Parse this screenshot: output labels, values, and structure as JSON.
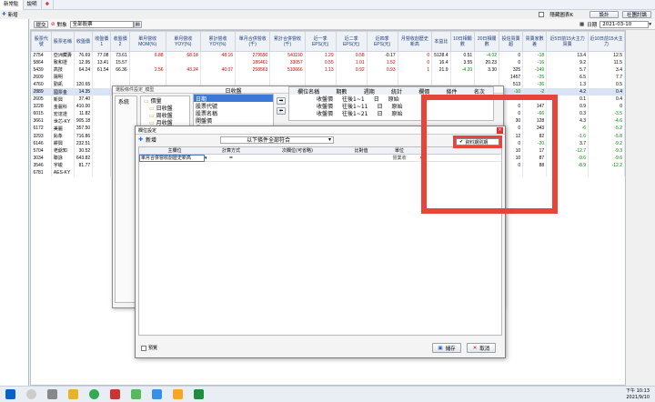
{
  "tabs": [
    "新常駐",
    "說明"
  ],
  "toolbar": {
    "new_label": "新增",
    "right_check": "隱藏圖表K",
    "btn1": "設計",
    "btn2": "社團討論",
    "date_label": "日期",
    "date_value": "2021-03-10"
  },
  "filter": {
    "tag": "提交",
    "label": "對象",
    "combo": "全部股票"
  },
  "grid": {
    "headers": [
      "股票代號",
      "股票名稱",
      "收盤價",
      "收盤價1",
      "收盤價2",
      "單月營收MOM(%)",
      "單月營收YOY(%)",
      "累計營收YOY(%)",
      "單月合併營收(千)",
      "累計合併營收(千)",
      "近一季EPS(元)",
      "近二季EPS(元)",
      "近四季EPS(元)",
      "月營收創歷史新高",
      "本益比",
      "10日相關數",
      "20日相關數",
      "投信買賣超",
      "買賣家數差",
      "近5日前15大主力買賣",
      "近10日前15大主力"
    ],
    "rows": [
      [
        "2754",
        "亞洲藏壽",
        "76.69",
        "77.08",
        "73.61",
        "6.88",
        "68.18",
        "48.16",
        "279590",
        "541190",
        "1.29",
        "0.58",
        "-0.17",
        "0",
        "5128.4",
        "0.51",
        "-4.02",
        "0",
        "-18",
        "13.4",
        "12.5"
      ],
      [
        "5864",
        "致和證",
        "12.95",
        "13.41",
        "15.57",
        "",
        "",
        "",
        "186461",
        "33057",
        "0.55",
        "1.01",
        "1.52",
        "0",
        "16.4",
        "3.55",
        "20.23",
        "0",
        "-16",
        "9.2",
        "11.5"
      ],
      [
        "5439",
        "高技",
        "64.24",
        "61.54",
        "66.36",
        "2.56",
        "43.24",
        "40.07",
        "258563",
        "510666",
        "1.13",
        "0.92",
        "0.93",
        "1",
        "21.9",
        "-4.20",
        "3.30",
        "325",
        "-149",
        "5.7",
        "3.4"
      ],
      [
        "2609",
        "陽明",
        "",
        "",
        "",
        "",
        "",
        "",
        "",
        "",
        "",
        "",
        "",
        "",
        "",
        "",
        "",
        "1457",
        "-25",
        "6.5",
        "7.7"
      ],
      [
        "4760",
        "勤凱",
        "120.65",
        "",
        "",
        "",
        "",
        "",
        "",
        "",
        "",
        "",
        "",
        "",
        "",
        "",
        "",
        "513",
        "-36",
        "1.3",
        "0.5"
      ],
      [
        "2889",
        "國票金",
        "14.35",
        "",
        "",
        "",
        "",
        "",
        "",
        "",
        "",
        "",
        "",
        "",
        "",
        "",
        "",
        "-10",
        "-2",
        "4.2",
        "0.4"
      ],
      [
        "2605",
        "新興",
        "37.40",
        "",
        "",
        "",
        "",
        "",
        "",
        "",
        "",
        "",
        "",
        "",
        "",
        "",
        "",
        "",
        "",
        "0.1",
        "0.4"
      ],
      [
        "3228",
        "金麗科",
        "410.00",
        "",
        "",
        "",
        "",
        "",
        "",
        "",
        "",
        "",
        "",
        "",
        "",
        "",
        "",
        "0",
        "147",
        "0.9",
        "0"
      ],
      [
        "6015",
        "宏達證",
        "11.82",
        "",
        "",
        "",
        "",
        "",
        "",
        "",
        "",
        "",
        "",
        "",
        "",
        "",
        "",
        "0",
        "-66",
        "0.3",
        "-3.5"
      ],
      [
        "3661",
        "世芯-KY",
        "905.18",
        "",
        "",
        "",
        "",
        "",
        "",
        "",
        "",
        "",
        "",
        "",
        "",
        "",
        "",
        "30",
        "128",
        "4.3",
        "-4.6"
      ],
      [
        "6172",
        "美麗",
        "357.50",
        "",
        "",
        "",
        "",
        "",
        "",
        "",
        "",
        "",
        "",
        "",
        "",
        "",
        "",
        "0",
        "343",
        "-6",
        "-5.2"
      ],
      [
        "3293",
        "鈊象",
        "716.86",
        "",
        "",
        "",
        "",
        "",
        "",
        "",
        "",
        "",
        "",
        "",
        "",
        "",
        "",
        "12",
        "82",
        "-1.6",
        "-5.8"
      ],
      [
        "6146",
        "耕興",
        "232.51",
        "",
        "",
        "",
        "",
        "",
        "",
        "",
        "",
        "",
        "",
        "",
        "",
        "",
        "",
        "0",
        "-20",
        "3.7",
        "-9.2"
      ],
      [
        "5704",
        "老爺知",
        "30.52",
        "",
        "",
        "",
        "",
        "",
        "",
        "",
        "",
        "",
        "",
        "",
        "",
        "",
        "",
        "10",
        "17",
        "-12.7",
        "-9.3"
      ],
      [
        "3034",
        "聯詠",
        "643.82",
        "",
        "",
        "",
        "",
        "",
        "",
        "",
        "",
        "",
        "",
        "",
        "",
        "",
        "",
        "10",
        "87",
        "-9.6",
        "-9.6"
      ],
      [
        "3546",
        "宇峻",
        "81.77",
        "",
        "",
        "",
        "",
        "",
        "",
        "",
        "",
        "",
        "",
        "",
        "",
        "",
        "",
        "0",
        "88",
        "-8.9",
        "-12.2"
      ],
      [
        "6781",
        "AES-KY",
        "",
        "",
        "",
        "",
        "",
        "",
        "",
        "",
        "",
        "",
        "",
        "",
        "",
        "",
        "",
        "",
        "",
        "",
        ""
      ]
    ]
  },
  "dialog1": {
    "title": "選股條件設定_模型",
    "left_tab": "系統",
    "list_header": "日收盤",
    "tree": [
      "價量",
      "日收盤",
      "周收盤",
      "月收盤",
      "籌碼",
      "財務",
      "公司",
      "常用",
      "temp"
    ],
    "list_items": [
      "日期",
      "股票代號",
      "股票名稱",
      "開盤價",
      "最高價"
    ],
    "columns": [
      "欄位名稱",
      "期數",
      "週期",
      "統計",
      "欄價",
      "條件",
      "名次"
    ],
    "rows": [
      [
        "收盤價",
        "往後1~1",
        "日",
        "原始"
      ],
      [
        "收盤價",
        "往後1~11",
        "日",
        "原始"
      ],
      [
        "收盤價",
        "往後1~21",
        "日",
        "原始"
      ]
    ]
  },
  "dialog2": {
    "title": "欄位設定",
    "new_label": "新增",
    "mode": "以下條件全部符合",
    "columns": [
      "主欄位",
      "計算方式",
      "次欄位(可省略)",
      "比對值",
      "單位"
    ],
    "row": {
      "main": "單月合併營收創歷史新高",
      "calc": "=",
      "unit": "營業收"
    },
    "date_option": "資料期別期",
    "preview_label": "預覽",
    "save_label": "儲存",
    "cancel_label": "取消"
  },
  "taskbar": {
    "time": "下午 10:13",
    "date": "2021/9/10"
  },
  "colors": {
    "highlight": "#e8453a",
    "header_text": "#1a3a7a",
    "selected": "#d8e4f6"
  }
}
